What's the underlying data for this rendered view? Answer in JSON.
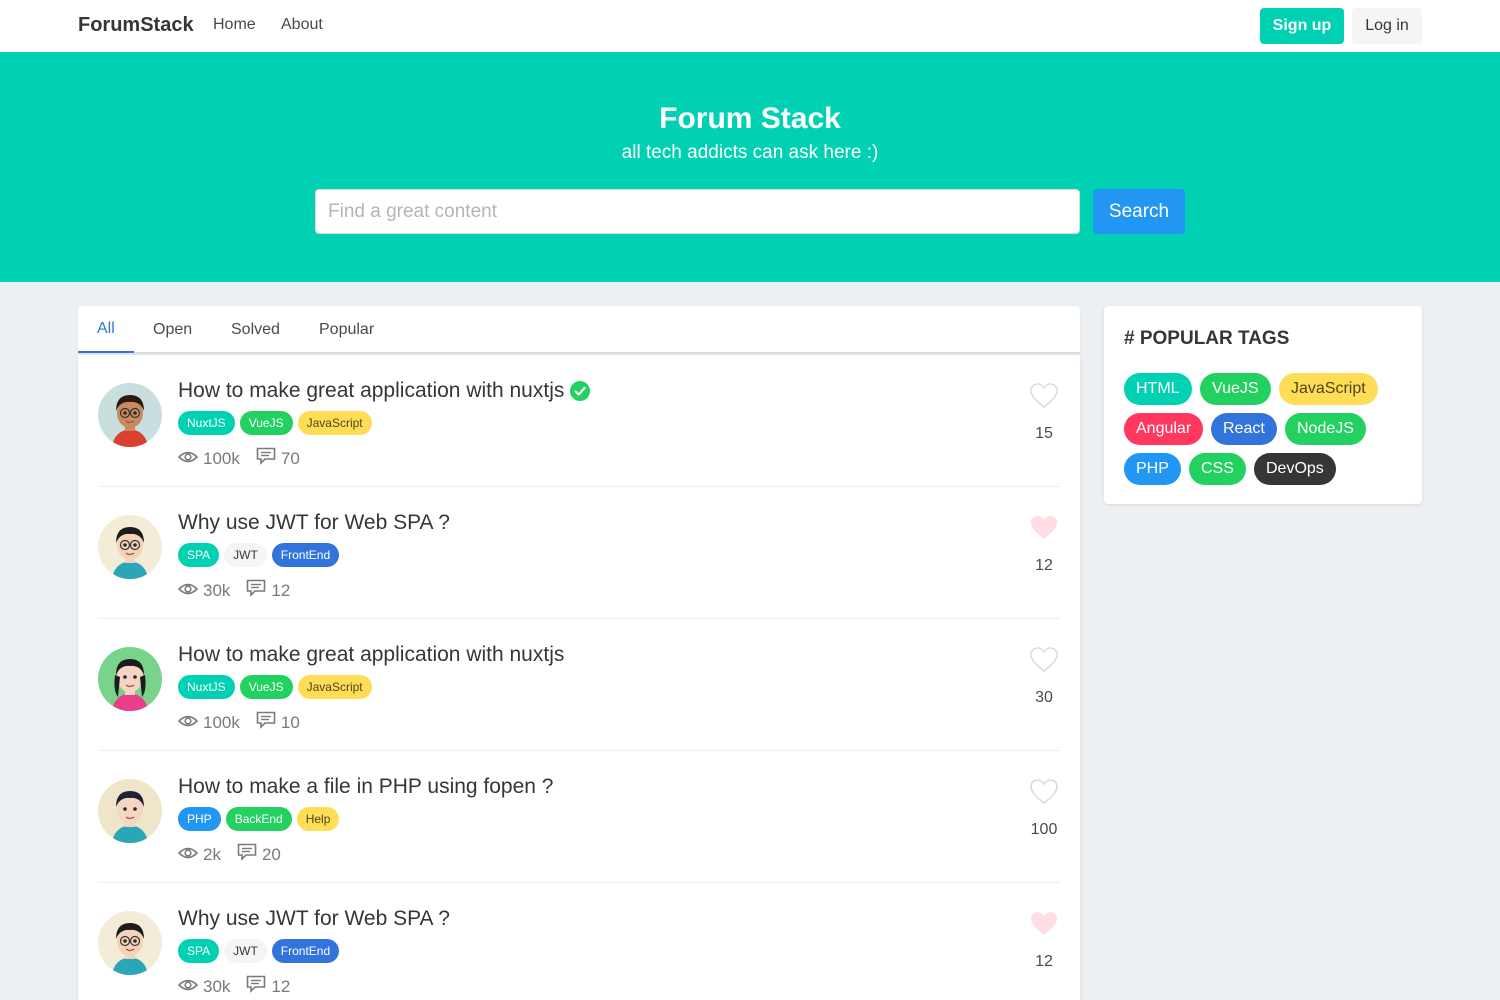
{
  "navbar": {
    "brand": "ForumStack",
    "links": [
      "Home",
      "About"
    ],
    "signup_label": "Sign up",
    "login_label": "Log in"
  },
  "hero": {
    "title": "Forum Stack",
    "subtitle": "all tech addicts can ask here :)",
    "search_placeholder": "Find a great content",
    "search_label": "Search"
  },
  "tabs": [
    {
      "label": "All",
      "active": true
    },
    {
      "label": "Open",
      "active": false
    },
    {
      "label": "Solved",
      "active": false
    },
    {
      "label": "Popular",
      "active": false
    }
  ],
  "questions": [
    {
      "title": "How to make great application with nuxtjs",
      "solved": true,
      "tags": [
        "NuxtJS",
        "VueJS",
        "JavaScript"
      ],
      "views": "100k",
      "comments": "70",
      "likes": "15",
      "liked": false
    },
    {
      "title": "Why use JWT for Web SPA ?",
      "solved": false,
      "tags": [
        "SPA",
        "JWT",
        "FrontEnd"
      ],
      "views": "30k",
      "comments": "12",
      "likes": "12",
      "liked": true
    },
    {
      "title": "How to make great application with nuxtjs",
      "solved": false,
      "tags": [
        "NuxtJS",
        "VueJS",
        "JavaScript"
      ],
      "views": "100k",
      "comments": "10",
      "likes": "30",
      "liked": false
    },
    {
      "title": "How to make a file in PHP using fopen ?",
      "solved": false,
      "tags": [
        "PHP",
        "BackEnd",
        "Help"
      ],
      "views": "2k",
      "comments": "20",
      "likes": "100",
      "liked": false
    },
    {
      "title": "Why use JWT for Web SPA ?",
      "solved": false,
      "tags": [
        "SPA",
        "JWT",
        "FrontEnd"
      ],
      "views": "30k",
      "comments": "12",
      "likes": "12",
      "liked": true
    }
  ],
  "popular_tags": {
    "title": "# POPULAR TAGS",
    "tags": [
      "HTML",
      "VueJS",
      "JavaScript",
      "Angular",
      "React",
      "NodeJS",
      "PHP",
      "CSS",
      "DevOps"
    ]
  },
  "tag_colors": {
    "NuxtJS": {
      "bg": "#00d1b2",
      "fg": "#ffffff"
    },
    "VueJS": {
      "bg": "#23d160",
      "fg": "#ffffff"
    },
    "JavaScript": {
      "bg": "#ffdd57",
      "fg": "rgba(0,0,0,0.7)"
    },
    "SPA": {
      "bg": "#00d1b2",
      "fg": "#ffffff"
    },
    "JWT": {
      "bg": "#f5f5f5",
      "fg": "#363636"
    },
    "FrontEnd": {
      "bg": "#3273dc",
      "fg": "#ffffff"
    },
    "PHP": {
      "bg": "#2196f3",
      "fg": "#ffffff"
    },
    "BackEnd": {
      "bg": "#23d160",
      "fg": "#ffffff"
    },
    "Help": {
      "bg": "#ffdd57",
      "fg": "rgba(0,0,0,0.7)"
    },
    "HTML": {
      "bg": "#00d1b2",
      "fg": "#ffffff"
    },
    "Angular": {
      "bg": "#ff3860",
      "fg": "#ffffff"
    },
    "React": {
      "bg": "#3273dc",
      "fg": "#ffffff"
    },
    "NodeJS": {
      "bg": "#23d160",
      "fg": "#ffffff"
    },
    "CSS": {
      "bg": "#23d160",
      "fg": "#ffffff"
    },
    "DevOps": {
      "bg": "#363636",
      "fg": "#ffffff"
    }
  },
  "icons": {
    "views": "eye-icon",
    "comments": "comment-icon",
    "like": "heart-icon",
    "solved": "check-circle-icon"
  },
  "colors": {
    "primary": "#00d1b2",
    "link": "#3273dc",
    "info": "#2196f3",
    "liked": "#ffdde5",
    "unliked": "#dbdbdb"
  }
}
